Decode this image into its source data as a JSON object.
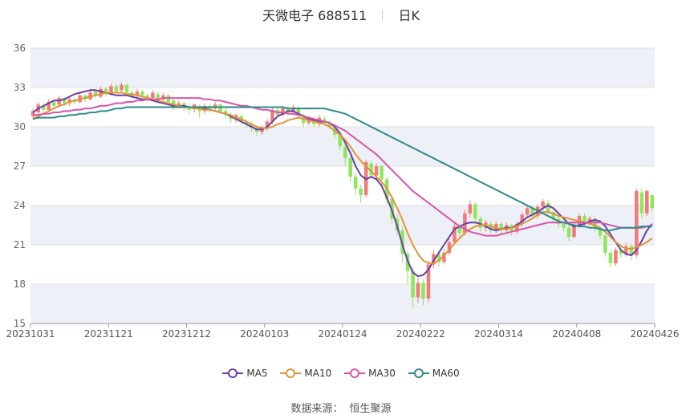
{
  "header": {
    "stock_name": "天微电子",
    "stock_code": "688511",
    "period": "日K"
  },
  "source": {
    "label": "数据来源：",
    "value": "恒生聚源"
  },
  "colors": {
    "up": "#ef7b7b",
    "down": "#8fe65c",
    "MA5": "#6a3fa8",
    "MA10": "#e0953a",
    "MA30": "#d955a8",
    "MA60": "#2e8b8b",
    "band": "#eef0f7",
    "grid": "#e0e0e0"
  },
  "chart_data": {
    "type": "candlestick",
    "y_ticks": [
      15,
      18,
      21,
      24,
      27,
      30,
      33,
      36
    ],
    "ylim": [
      15,
      36
    ],
    "x_tick_labels": [
      "20231031",
      "20231121",
      "20231212",
      "20240103",
      "20240124",
      "20240222",
      "20240314",
      "20240408",
      "20240426"
    ],
    "n_candles": 120,
    "candles": [
      [
        30.8,
        31.2,
        31.4,
        30.5
      ],
      [
        31.1,
        31.7,
        31.9,
        30.9
      ],
      [
        31.6,
        31.3,
        31.8,
        31.1
      ],
      [
        31.3,
        31.9,
        32.1,
        31.2
      ],
      [
        31.9,
        31.6,
        32.0,
        31.4
      ],
      [
        31.7,
        32.2,
        32.4,
        31.5
      ],
      [
        32.2,
        31.8,
        32.3,
        31.6
      ],
      [
        31.8,
        32.1,
        32.3,
        31.6
      ],
      [
        32.1,
        31.9,
        32.2,
        31.7
      ],
      [
        31.9,
        32.4,
        32.6,
        31.8
      ],
      [
        32.4,
        32.1,
        32.5,
        31.9
      ],
      [
        32.1,
        32.6,
        32.9,
        32.0
      ],
      [
        32.7,
        32.4,
        32.8,
        32.2
      ],
      [
        32.3,
        32.9,
        33.1,
        32.2
      ],
      [
        32.9,
        32.5,
        33.0,
        32.3
      ],
      [
        32.6,
        33.1,
        33.3,
        32.4
      ],
      [
        33.1,
        32.7,
        33.3,
        32.5
      ],
      [
        32.8,
        33.2,
        33.4,
        32.6
      ],
      [
        33.2,
        32.6,
        33.3,
        32.4
      ],
      [
        32.6,
        32.3,
        32.8,
        32.1
      ],
      [
        32.4,
        32.7,
        32.9,
        32.2
      ],
      [
        32.7,
        32.4,
        32.8,
        32.2
      ],
      [
        32.4,
        32.2,
        32.5,
        31.9
      ],
      [
        32.2,
        32.6,
        32.8,
        32.0
      ],
      [
        32.5,
        32.1,
        32.7,
        31.9
      ],
      [
        32.1,
        32.4,
        32.6,
        31.9
      ],
      [
        32.4,
        31.9,
        32.5,
        31.7
      ],
      [
        32.0,
        31.6,
        32.1,
        31.3
      ],
      [
        31.6,
        31.8,
        32.0,
        31.4
      ],
      [
        31.8,
        31.5,
        31.9,
        31.2
      ],
      [
        31.5,
        31.3,
        31.7,
        31.0
      ],
      [
        31.4,
        31.7,
        31.8,
        31.1
      ],
      [
        31.6,
        31.2,
        31.7,
        30.7
      ],
      [
        31.2,
        31.6,
        31.8,
        31.0
      ],
      [
        31.6,
        31.3,
        31.7,
        31.1
      ],
      [
        31.4,
        31.7,
        31.9,
        31.2
      ],
      [
        31.7,
        31.2,
        31.8,
        31.0
      ],
      [
        31.2,
        30.9,
        31.4,
        30.6
      ],
      [
        30.9,
        30.6,
        31.1,
        30.3
      ],
      [
        30.6,
        30.9,
        31.0,
        30.3
      ],
      [
        30.8,
        30.4,
        31.0,
        30.1
      ],
      [
        30.4,
        30.2,
        30.6,
        29.9
      ],
      [
        30.2,
        29.9,
        30.4,
        29.6
      ],
      [
        29.9,
        29.6,
        30.1,
        29.3
      ],
      [
        29.6,
        29.9,
        30.1,
        29.4
      ],
      [
        29.9,
        30.4,
        30.6,
        29.7
      ],
      [
        30.4,
        31.3,
        31.5,
        30.2
      ],
      [
        31.3,
        30.9,
        31.5,
        30.7
      ],
      [
        30.9,
        31.4,
        31.6,
        30.8
      ],
      [
        31.4,
        31.1,
        31.6,
        30.9
      ],
      [
        31.1,
        31.5,
        31.7,
        30.9
      ],
      [
        31.4,
        30.9,
        31.6,
        30.7
      ],
      [
        30.9,
        30.3,
        31.0,
        30.0
      ],
      [
        30.3,
        30.6,
        30.8,
        30.1
      ],
      [
        30.6,
        30.2,
        30.8,
        30.0
      ],
      [
        30.2,
        30.7,
        30.9,
        30.0
      ],
      [
        30.6,
        30.3,
        30.8,
        30.1
      ],
      [
        30.3,
        30.0,
        30.5,
        29.8
      ],
      [
        30.0,
        29.4,
        30.2,
        29.1
      ],
      [
        29.4,
        28.5,
        29.6,
        28.2
      ],
      [
        28.5,
        27.6,
        28.8,
        27.0
      ],
      [
        27.6,
        26.2,
        27.8,
        25.8
      ],
      [
        26.2,
        25.3,
        26.5,
        24.9
      ],
      [
        25.3,
        24.8,
        25.6,
        24.2
      ],
      [
        24.8,
        27.3,
        27.5,
        24.6
      ],
      [
        27.2,
        26.3,
        27.4,
        26.0
      ],
      [
        26.3,
        27.0,
        27.2,
        25.9
      ],
      [
        27.0,
        26.0,
        27.1,
        25.5
      ],
      [
        26.0,
        24.5,
        26.2,
        24.1
      ],
      [
        24.5,
        23.0,
        24.8,
        22.6
      ],
      [
        23.0,
        22.1,
        23.3,
        21.7
      ],
      [
        22.1,
        20.3,
        22.4,
        19.7
      ],
      [
        20.3,
        19.0,
        20.6,
        18.0
      ],
      [
        19.0,
        17.0,
        19.3,
        16.2
      ],
      [
        17.0,
        18.1,
        18.5,
        16.6
      ],
      [
        18.1,
        16.9,
        18.4,
        16.4
      ],
      [
        16.9,
        19.5,
        19.8,
        16.6
      ],
      [
        19.5,
        20.3,
        20.6,
        19.2
      ],
      [
        20.3,
        19.7,
        20.5,
        19.3
      ],
      [
        19.7,
        20.4,
        20.7,
        19.5
      ],
      [
        20.4,
        21.2,
        21.5,
        20.2
      ],
      [
        21.2,
        22.4,
        22.7,
        21.0
      ],
      [
        22.4,
        21.9,
        22.6,
        21.6
      ],
      [
        21.9,
        23.4,
        23.7,
        21.7
      ],
      [
        23.4,
        24.1,
        24.4,
        23.1
      ],
      [
        24.1,
        23.0,
        24.2,
        22.7
      ],
      [
        23.0,
        22.3,
        23.2,
        22.0
      ],
      [
        22.3,
        22.7,
        22.9,
        22.0
      ],
      [
        22.6,
        22.1,
        22.8,
        21.8
      ],
      [
        22.1,
        22.6,
        22.8,
        21.9
      ],
      [
        22.6,
        22.1,
        22.7,
        21.8
      ],
      [
        22.1,
        22.5,
        22.7,
        21.9
      ],
      [
        22.5,
        22.0,
        22.6,
        21.7
      ],
      [
        22.0,
        22.6,
        22.8,
        21.8
      ],
      [
        22.6,
        23.3,
        23.5,
        22.4
      ],
      [
        23.3,
        23.8,
        24.0,
        23.1
      ],
      [
        23.8,
        23.2,
        24.0,
        23.0
      ],
      [
        23.2,
        23.9,
        24.1,
        23.0
      ],
      [
        23.9,
        24.3,
        24.5,
        23.6
      ],
      [
        24.2,
        23.5,
        24.4,
        23.3
      ],
      [
        23.5,
        23.0,
        23.6,
        22.7
      ],
      [
        23.0,
        22.6,
        23.1,
        22.3
      ],
      [
        22.6,
        22.3,
        22.8,
        22.0
      ],
      [
        22.3,
        21.6,
        22.5,
        21.3
      ],
      [
        21.6,
        22.5,
        22.7,
        21.5
      ],
      [
        22.5,
        23.2,
        23.4,
        22.3
      ],
      [
        23.2,
        22.6,
        23.4,
        22.4
      ],
      [
        22.6,
        23.0,
        23.2,
        22.5
      ],
      [
        23.0,
        22.3,
        23.1,
        22.0
      ],
      [
        22.3,
        21.7,
        22.4,
        21.4
      ],
      [
        21.7,
        20.4,
        21.9,
        20.1
      ],
      [
        20.4,
        19.6,
        20.6,
        19.3
      ],
      [
        19.6,
        20.6,
        20.8,
        19.4
      ],
      [
        20.6,
        20.3,
        20.8,
        20.0
      ],
      [
        20.3,
        20.9,
        21.1,
        20.1
      ],
      [
        20.9,
        20.2,
        21.1,
        19.8
      ],
      [
        20.2,
        25.1,
        25.3,
        20.0
      ],
      [
        25.0,
        23.4,
        25.3,
        23.0
      ],
      [
        23.4,
        25.1,
        25.2,
        23.2
      ],
      [
        24.8,
        23.8,
        24.8,
        23.5
      ]
    ],
    "series": [
      {
        "name": "MA5",
        "values": [
          31.1,
          31.4,
          31.6,
          31.8,
          32.0,
          32.0,
          32.1,
          32.3,
          32.5,
          32.6,
          32.7,
          32.8,
          32.8,
          32.7,
          32.6,
          32.5,
          32.4,
          32.4,
          32.4,
          32.3,
          32.2,
          32.1,
          32.1,
          32.0,
          31.9,
          31.8,
          31.7,
          31.6,
          31.6,
          31.6,
          31.5,
          31.5,
          31.5,
          31.4,
          31.3,
          31.2,
          31.1,
          31.0,
          30.8,
          30.6,
          30.4,
          30.2,
          30.0,
          29.8,
          29.8,
          30.0,
          30.4,
          30.8,
          31.0,
          31.2,
          31.2,
          31.0,
          30.8,
          30.6,
          30.5,
          30.4,
          30.4,
          30.3,
          30.0,
          29.5,
          28.8,
          28.0,
          27.0,
          26.3,
          26.0,
          26.2,
          26.0,
          25.5,
          24.6,
          23.6,
          22.4,
          21.0,
          19.8,
          18.9,
          18.6,
          18.7,
          19.1,
          19.8,
          20.4,
          21.0,
          21.6,
          22.2,
          22.4,
          22.6,
          22.7,
          22.7,
          22.6,
          22.4,
          22.2,
          22.1,
          22.2,
          22.3,
          22.3,
          22.5,
          22.8,
          23.1,
          23.3,
          23.5,
          23.8,
          24.0,
          23.8,
          23.4,
          23.0,
          22.6,
          22.4,
          22.5,
          22.6,
          22.8,
          22.9,
          22.8,
          22.4,
          21.8,
          21.2,
          20.6,
          20.3,
          20.2,
          20.6,
          21.3,
          22.1,
          22.6
        ]
      },
      {
        "name": "MA10",
        "values": [
          30.6,
          30.8,
          31.0,
          31.2,
          31.4,
          31.6,
          31.7,
          31.9,
          32.0,
          32.1,
          32.2,
          32.3,
          32.4,
          32.5,
          32.6,
          32.6,
          32.6,
          32.6,
          32.5,
          32.5,
          32.4,
          32.3,
          32.2,
          32.1,
          32.0,
          31.9,
          31.8,
          31.7,
          31.6,
          31.5,
          31.5,
          31.4,
          31.4,
          31.3,
          31.3,
          31.2,
          31.1,
          31.0,
          30.9,
          30.7,
          30.6,
          30.4,
          30.2,
          30.0,
          29.9,
          29.9,
          30.0,
          30.2,
          30.3,
          30.5,
          30.6,
          30.7,
          30.6,
          30.5,
          30.4,
          30.3,
          30.2,
          30.0,
          29.7,
          29.4,
          29.0,
          28.5,
          27.9,
          27.4,
          27.0,
          26.6,
          26.2,
          25.8,
          25.3,
          24.6,
          23.8,
          22.9,
          21.9,
          21.0,
          20.3,
          19.8,
          19.6,
          19.6,
          19.8,
          20.2,
          20.6,
          21.1,
          21.5,
          21.9,
          22.2,
          22.4,
          22.5,
          22.5,
          22.4,
          22.3,
          22.2,
          22.2,
          22.3,
          22.4,
          22.6,
          22.8,
          23.0,
          23.3,
          23.5,
          23.5,
          23.4,
          23.2,
          23.1,
          23.0,
          22.9,
          22.8,
          22.7,
          22.6,
          22.5,
          22.3,
          22.0,
          21.6,
          21.2,
          20.9,
          20.7,
          20.7,
          20.8,
          21.0,
          21.2,
          21.5
        ]
      },
      {
        "name": "MA30",
        "values": [
          30.9,
          30.9,
          31.0,
          31.0,
          31.1,
          31.1,
          31.2,
          31.2,
          31.3,
          31.3,
          31.4,
          31.4,
          31.5,
          31.6,
          31.6,
          31.7,
          31.8,
          31.8,
          31.9,
          31.9,
          32.0,
          32.0,
          32.1,
          32.1,
          32.1,
          32.2,
          32.2,
          32.2,
          32.2,
          32.2,
          32.2,
          32.2,
          32.2,
          32.1,
          32.1,
          32.0,
          32.0,
          31.9,
          31.8,
          31.7,
          31.6,
          31.6,
          31.5,
          31.4,
          31.3,
          31.3,
          31.2,
          31.1,
          31.1,
          31.0,
          31.0,
          30.9,
          30.8,
          30.7,
          30.6,
          30.5,
          30.4,
          30.3,
          30.1,
          29.9,
          29.7,
          29.4,
          29.1,
          28.8,
          28.5,
          28.2,
          27.9,
          27.5,
          27.1,
          26.7,
          26.3,
          25.9,
          25.5,
          25.1,
          24.8,
          24.5,
          24.2,
          23.9,
          23.6,
          23.3,
          23.0,
          22.7,
          22.4,
          22.2,
          22.0,
          21.9,
          21.8,
          21.7,
          21.7,
          21.7,
          21.8,
          21.9,
          22.0,
          22.1,
          22.2,
          22.3,
          22.4,
          22.5,
          22.6,
          22.7,
          22.7,
          22.7,
          22.7,
          22.7,
          22.7,
          22.7,
          22.7,
          22.7,
          22.7,
          22.7,
          22.6,
          22.5,
          22.4,
          22.3,
          22.3,
          22.3,
          22.3,
          22.3,
          22.4,
          22.5
        ]
      },
      {
        "name": "MA60",
        "values": [
          30.6,
          30.7,
          30.7,
          30.7,
          30.7,
          30.8,
          30.8,
          30.9,
          30.9,
          31.0,
          31.0,
          31.1,
          31.1,
          31.2,
          31.2,
          31.3,
          31.4,
          31.4,
          31.5,
          31.5,
          31.5,
          31.5,
          31.5,
          31.5,
          31.5,
          31.5,
          31.5,
          31.5,
          31.5,
          31.5,
          31.5,
          31.5,
          31.5,
          31.5,
          31.5,
          31.5,
          31.5,
          31.5,
          31.5,
          31.5,
          31.5,
          31.5,
          31.5,
          31.5,
          31.5,
          31.5,
          31.5,
          31.5,
          31.5,
          31.4,
          31.4,
          31.4,
          31.4,
          31.4,
          31.4,
          31.4,
          31.4,
          31.3,
          31.2,
          31.1,
          31.0,
          30.8,
          30.6,
          30.4,
          30.2,
          30.0,
          29.8,
          29.6,
          29.4,
          29.2,
          29.0,
          28.8,
          28.6,
          28.4,
          28.2,
          28.0,
          27.8,
          27.6,
          27.4,
          27.2,
          27.0,
          26.8,
          26.6,
          26.4,
          26.2,
          26.0,
          25.8,
          25.6,
          25.4,
          25.2,
          25.0,
          24.8,
          24.6,
          24.4,
          24.2,
          24.0,
          23.8,
          23.6,
          23.4,
          23.2,
          23.0,
          22.8,
          22.7,
          22.6,
          22.5,
          22.4,
          22.4,
          22.3,
          22.3,
          22.2,
          22.1,
          22.1,
          22.2,
          22.3,
          22.3,
          22.3,
          22.3,
          22.4,
          22.4,
          22.4
        ]
      }
    ]
  }
}
